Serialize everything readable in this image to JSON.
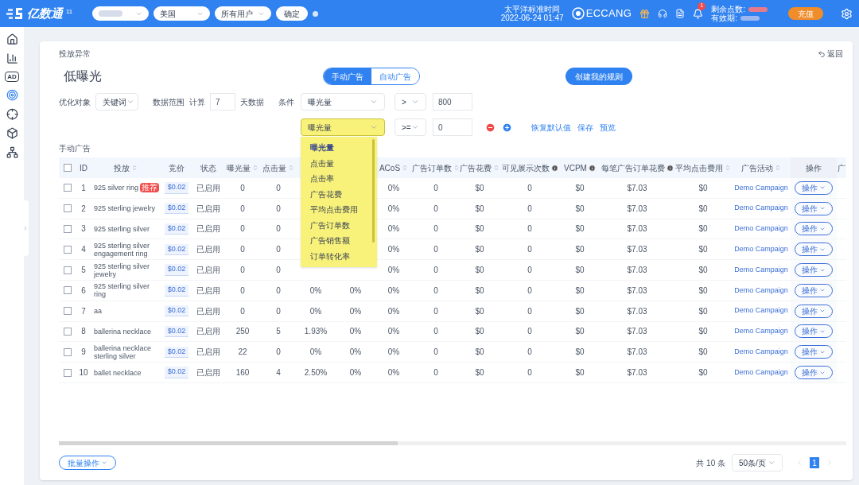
{
  "top_bar": {
    "logo": "亿数通",
    "logo_mark": "11",
    "selects": [
      {
        "kind": "redacted"
      },
      {
        "kind": "text",
        "value": "美国"
      },
      {
        "kind": "text",
        "value": "所有用户"
      }
    ],
    "confirm_button": "确定",
    "timezone": "太平洋标准时间",
    "datetime": "2022-06-24 01:47",
    "brand": "ECCANG",
    "notification_count": "1",
    "points_label": "剩余点数:",
    "expiry_label": "有效期:",
    "recharge_button": "充值"
  },
  "sidebar": {
    "ad_label": "AD"
  },
  "breadcrumb": "投放异常",
  "back_link": "返回",
  "title": "低曝光",
  "ad_type_tabs": [
    {
      "label": "手动广告",
      "selected": true
    },
    {
      "label": "自动广告",
      "selected": false
    }
  ],
  "create_rule_button": "创建我的规则",
  "filters": {
    "target_label": "优化对象",
    "target_value": "关键词",
    "range_label": "数据范围",
    "calc_label": "计算",
    "days": "7",
    "days_suffix": "天数据",
    "condition_label": "条件"
  },
  "conditions": [
    {
      "metric": "曝光量",
      "operator": ">",
      "value": "800",
      "open": false
    },
    {
      "metric": "曝光量",
      "operator": ">=",
      "value": "0",
      "open": true
    }
  ],
  "condition_actions": [
    "恢复默认值",
    "保存",
    "预览"
  ],
  "metric_options": [
    {
      "label": "曝光量",
      "selected": true
    },
    {
      "label": "点击量",
      "selected": false
    },
    {
      "label": "点击率",
      "selected": false
    },
    {
      "label": "广告花费",
      "selected": false
    },
    {
      "label": "平均点击费用",
      "selected": false
    },
    {
      "label": "广告订单数",
      "selected": false
    },
    {
      "label": "广告销售额",
      "selected": false
    },
    {
      "label": "订单转化率",
      "selected": false
    }
  ],
  "section_label": "手动广告",
  "table": {
    "select_all_checked": false,
    "columns": [
      {
        "kind": "text",
        "label": "ID"
      },
      {
        "kind": "keyword",
        "label": "投放",
        "sortable": true
      },
      {
        "kind": "bid",
        "label": "竞价"
      },
      {
        "kind": "text",
        "label": "状态"
      },
      {
        "kind": "text",
        "label": "曝光量",
        "sortable": true
      },
      {
        "kind": "text",
        "label": "点击量",
        "sortable": true
      },
      {
        "kind": "text"
      },
      {
        "kind": "text"
      },
      {
        "kind": "text",
        "label": "ACoS",
        "sortable": true
      },
      {
        "kind": "text",
        "label": "广告订单数",
        "sortable": true
      },
      {
        "kind": "text",
        "label": "广告花费",
        "sortable": true
      },
      {
        "kind": "text",
        "label": "可见展示次数",
        "info": true
      },
      {
        "kind": "text",
        "label": "VCPM",
        "info": true
      },
      {
        "kind": "text",
        "label": "每笔广告订单花费",
        "info": true
      },
      {
        "kind": "text",
        "label": "平均点击费用",
        "sortable": true
      },
      {
        "kind": "link",
        "label": "广告活动",
        "sortable": true
      },
      {
        "kind": "button",
        "label": "操作"
      },
      {
        "kind": "text",
        "label": "广"
      }
    ],
    "rows": [
      {
        "checked": false,
        "tag": "推荐",
        "cells": [
          "1",
          "925 silver ring",
          "$0.02",
          "已启用",
          "0",
          "0",
          null,
          null,
          "0%",
          "0",
          "$0",
          "0",
          "$0",
          "$7.03",
          "$0",
          "Demo Campaign",
          "操作"
        ]
      },
      {
        "checked": false,
        "cells": [
          "2",
          "925 sterling jewelry",
          "$0.02",
          "已启用",
          "0",
          "0",
          null,
          null,
          "0%",
          "0",
          "$0",
          "0",
          "$0",
          "$7.03",
          "$0",
          "Demo Campaign",
          "操作"
        ]
      },
      {
        "checked": false,
        "cells": [
          "3",
          "925 sterling silver",
          "$0.02",
          "已启用",
          "0",
          "0",
          null,
          null,
          "0%",
          "0",
          "$0",
          "0",
          "$0",
          "$7.03",
          "$0",
          "Demo Campaign",
          "操作"
        ]
      },
      {
        "checked": false,
        "cells": [
          "4",
          "925 sterling silver engagement ring",
          "$0.02",
          "已启用",
          "0",
          "0",
          null,
          null,
          "0%",
          "0",
          "$0",
          "0",
          "$0",
          "$7.03",
          "$0",
          "Demo Campaign",
          "操作"
        ]
      },
      {
        "checked": false,
        "cells": [
          "5",
          "925 sterling silver jewelry",
          "$0.02",
          "已启用",
          "0",
          "0",
          null,
          null,
          "0%",
          "0",
          "$0",
          "0",
          "$0",
          "$7.03",
          "$0",
          "Demo Campaign",
          "操作"
        ]
      },
      {
        "checked": false,
        "cells": [
          "6",
          "925 sterling silver ring",
          "$0.02",
          "已启用",
          "0",
          "0",
          "0%",
          "0%",
          "0%",
          "0",
          "$0",
          "0",
          "$0",
          "$7.03",
          "$0",
          "Demo Campaign",
          "操作"
        ]
      },
      {
        "checked": false,
        "cells": [
          "7",
          "aa",
          "$0.02",
          "已启用",
          "0",
          "0",
          "0%",
          "0%",
          "0%",
          "0",
          "$0",
          "0",
          "$0",
          "$7.03",
          "$0",
          "Demo Campaign",
          "操作"
        ]
      },
      {
        "checked": false,
        "cells": [
          "8",
          "ballerina necklace",
          "$0.02",
          "已启用",
          "250",
          "5",
          "1.93%",
          "0%",
          "0%",
          "0",
          "$0",
          "0",
          "$0",
          "$7.03",
          "$0",
          "Demo Campaign",
          "操作"
        ]
      },
      {
        "checked": false,
        "cells": [
          "9",
          "ballerina necklace sterling silver",
          "$0.02",
          "已启用",
          "22",
          "0",
          "0%",
          "0%",
          "0%",
          "0",
          "$0",
          "0",
          "$0",
          "$7.03",
          "$0",
          "Demo Campaign",
          "操作"
        ]
      },
      {
        "checked": false,
        "cells": [
          "10",
          "ballet necklace",
          "$0.02",
          "已启用",
          "160",
          "4",
          "2.50%",
          "0%",
          "0%",
          "0",
          "$0",
          "0",
          "$0",
          "$7.03",
          "$0",
          "Demo Campaign",
          "操作"
        ]
      }
    ]
  },
  "batch_button": "批量操作",
  "total": "共 10 条",
  "page_size": "50条/页",
  "pages": [
    {
      "label": "1",
      "selected": true
    }
  ]
}
